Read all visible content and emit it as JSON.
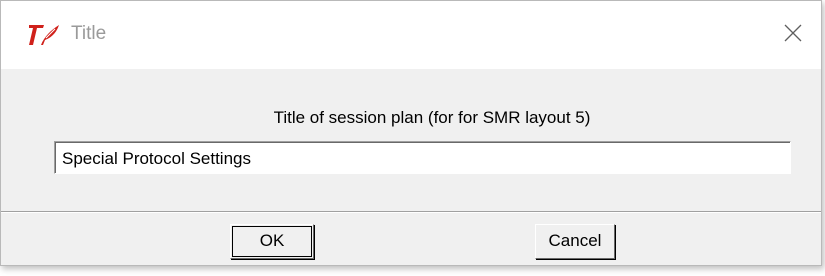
{
  "window": {
    "title": "Title",
    "app_icon": "tk-feather-logo-icon",
    "close_icon": "close-icon"
  },
  "form": {
    "prompt": "Title of session plan (for  for SMR layout 5)",
    "input_value": "Special Protocol Settings"
  },
  "buttons": {
    "ok_label": "OK",
    "cancel_label": "Cancel"
  },
  "colors": {
    "icon_red": "#d0211b",
    "title_gray": "#9a9a9a",
    "dialog_bg": "#f0f0f0"
  }
}
